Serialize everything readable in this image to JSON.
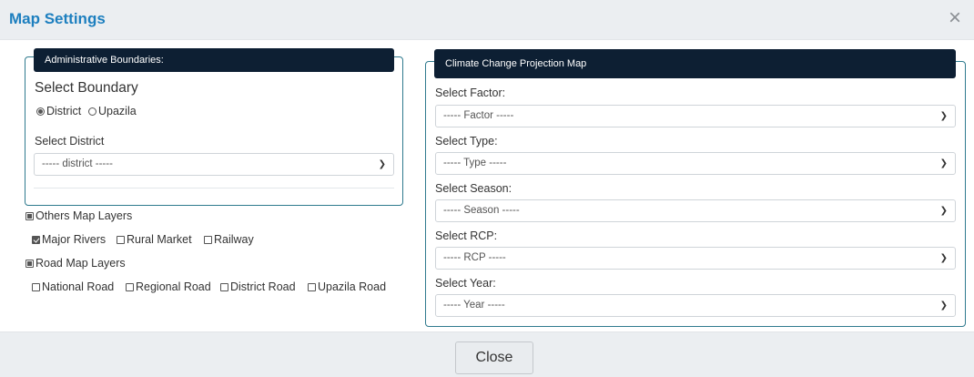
{
  "modal": {
    "title": "Map Settings",
    "close_icon": "×",
    "footer_button": "Close"
  },
  "admin_panel": {
    "header": "Administrative Boundaries:",
    "select_boundary_label": "Select Boundary",
    "boundary_options": [
      {
        "label": "District",
        "selected": true
      },
      {
        "label": "Upazila",
        "selected": false
      }
    ],
    "district_label": "Select District",
    "district_value": "----- district -----"
  },
  "layers": {
    "others_label": "Others Map Layers",
    "others": [
      {
        "label": "Major Rivers",
        "checked": true
      },
      {
        "label": "Rural Market",
        "checked": false
      },
      {
        "label": "Railway",
        "checked": false
      }
    ],
    "road_label": "Road Map Layers",
    "roads": [
      {
        "label": "National Road",
        "checked": false
      },
      {
        "label": "Regional Road",
        "checked": false
      },
      {
        "label": "District Road",
        "checked": false
      },
      {
        "label": "Upazila Road",
        "checked": false
      }
    ]
  },
  "climate_panel": {
    "header": "Climate Change Projection Map",
    "fields": [
      {
        "label": "Select Factor:",
        "value": "----- Factor -----"
      },
      {
        "label": "Select Type:",
        "value": "----- Type -----"
      },
      {
        "label": "Select Season:",
        "value": "----- Season -----"
      },
      {
        "label": "Select RCP:",
        "value": "----- RCP -----"
      },
      {
        "label": "Select Year:",
        "value": "----- Year -----"
      }
    ]
  },
  "colors": {
    "title": "#1d7fbf",
    "panel_header_bg": "#0d1f33",
    "panel_border": "#2f7a8e"
  },
  "icons": {
    "close": "close-icon",
    "select_arrow": "chevron-down-icon"
  }
}
